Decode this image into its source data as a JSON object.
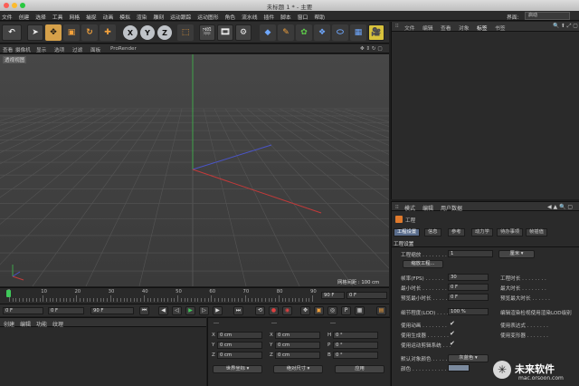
{
  "window": {
    "title": "未标题 1 * - 主要"
  },
  "menubar": {
    "items": [
      "文件",
      "创建",
      "选择",
      "工具",
      "网格",
      "捕捉",
      "动画",
      "模拟",
      "渲染",
      "雕刻",
      "运动跟踪",
      "运动图形",
      "角色",
      "流水线",
      "插件",
      "脚本",
      "窗口",
      "帮助"
    ],
    "layout_label": "界面:",
    "layout_value": "启动"
  },
  "toolbar": {
    "axis_x": "X",
    "axis_y": "Y",
    "axis_z": "Z"
  },
  "viewport": {
    "menu": [
      "查看",
      "摄像机",
      "显示",
      "选项",
      "过滤",
      "面板",
      "ProRender"
    ],
    "label": "透视视图",
    "grid_spacing": "网格间距 : 100 cm",
    "colors": {
      "x_axis": "#c23a3a",
      "y_axis": "#3fa34a",
      "z_axis": "#4a55c8"
    }
  },
  "timeline": {
    "ticks": [
      "0",
      "10",
      "20",
      "30",
      "40",
      "50",
      "60",
      "70",
      "80",
      "90"
    ],
    "current_frame": "0 F",
    "start": "0 F",
    "min": "0 F",
    "max": "90 F",
    "end": "90 F"
  },
  "object_manager": {
    "tabs": [
      "文件",
      "编辑",
      "查看",
      "对象",
      "标签",
      "书签"
    ]
  },
  "attribute_manager": {
    "tabs": [
      "模式",
      "编辑",
      "用户数据"
    ],
    "object_label": "工程",
    "subtabs": [
      "工程设置",
      "信息",
      "参考",
      "动力学",
      "待办事项",
      "帧插值"
    ],
    "section_title": "工程设置",
    "scale_label": "工程缩放 . . . . . . . .",
    "scale_value": "1",
    "scale_unit": "厘米",
    "scale_button": "缩放工程...",
    "fps_label": "帧率(FPS) . . . . . .",
    "fps_value": "30",
    "project_time_label": "工程时长 . . . . . . . .",
    "min_time_label": "最小时长 . . . . . . . .",
    "min_time_value": "0 F",
    "max_time_label": "最大时长 . . . . . . . .",
    "preview_min_label": "预览最小时长 . . . . . .",
    "preview_min_value": "0 F",
    "preview_max_label": "预览最大时长 . . . . . .",
    "lod_label": "细节程度(LOD) . . . .",
    "lod_value": "100 %",
    "render_lod_label": "编辑渲染检视使用渲染LOD级别",
    "use_animation": "使用动画 . . . . . . . .",
    "use_expression": "使用表达式 . . . . . . .",
    "use_generators": "使用生成器 . . . . . . .",
    "use_deformers": "使用变形器 . . . . . . .",
    "use_motion": "使用运动剪辑系统 . . .",
    "default_color_label": "默认对象颜色 . . . . .",
    "default_color_value": "灰蓝色",
    "color_label": "颜色 . . . . . . . . . . ."
  },
  "material_manager": {
    "tabs": [
      "创建",
      "编辑",
      "功能",
      "纹理"
    ]
  },
  "coordinates": {
    "header_left": "---",
    "header_mid": "---",
    "header_right": "---",
    "rows": [
      {
        "a": "X",
        "av": "0 cm",
        "b": "X",
        "bv": "0 cm",
        "c": "H",
        "cv": "0 °"
      },
      {
        "a": "Y",
        "av": "0 cm",
        "b": "Y",
        "bv": "0 cm",
        "c": "P",
        "cv": "0 °"
      },
      {
        "a": "Z",
        "av": "0 cm",
        "b": "Z",
        "bv": "0 cm",
        "c": "B",
        "cv": "0 °"
      }
    ],
    "world_select": "世界坐标",
    "scale_select": "绝对尺寸",
    "apply": "应用"
  },
  "watermark": {
    "title": "未来软件",
    "url": "mac.orsoon.com"
  }
}
